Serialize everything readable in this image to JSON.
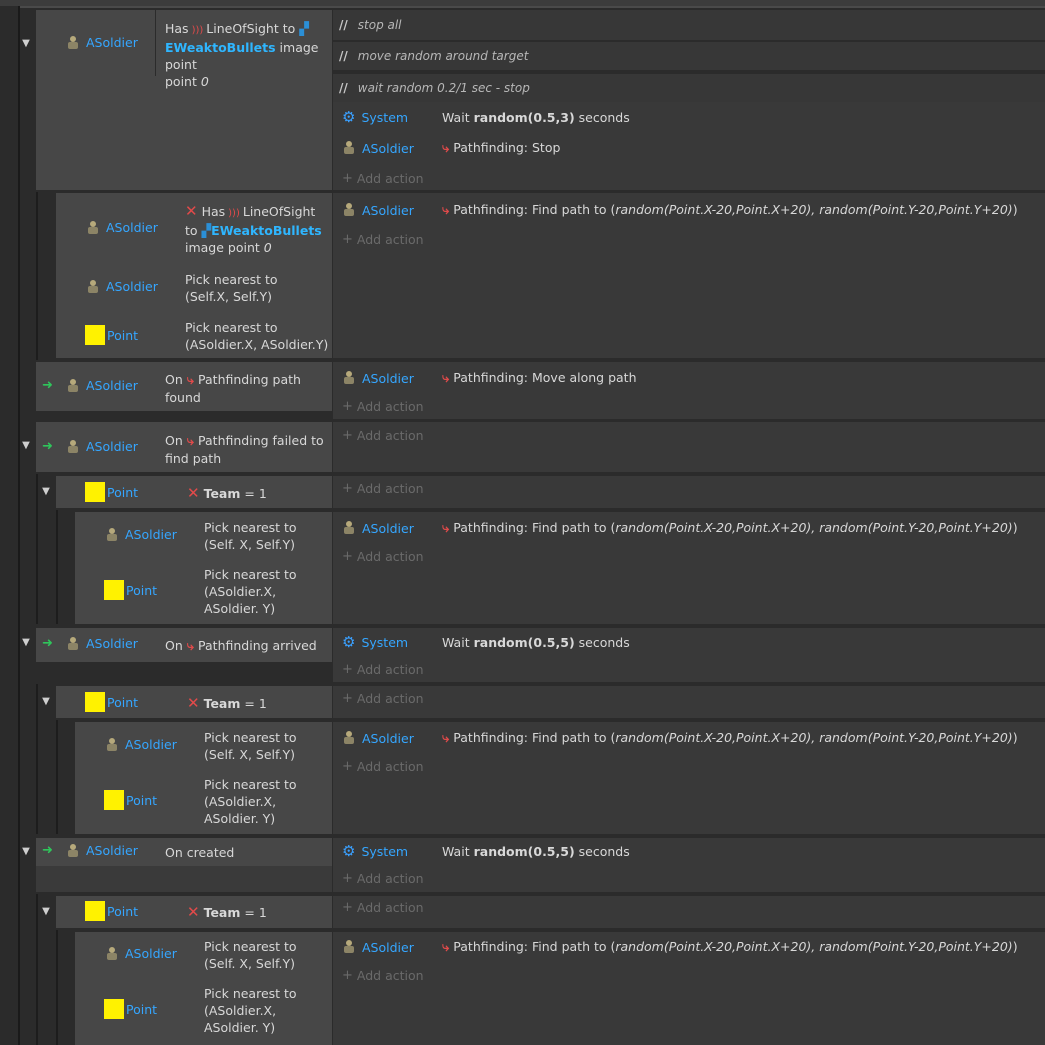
{
  "objects": {
    "soldier": "ASoldier",
    "point": "Point",
    "system": "System",
    "bullets": "EWeaktoBullets"
  },
  "comments": [
    "stop all",
    "move random around target",
    "wait random 0.2/1 sec - stop"
  ],
  "comment_marker": "//",
  "add_action": "Add action",
  "conditions": {
    "has": "Has",
    "line_of_sight_to": "LineOfSight to",
    "line_of_sight": "LineOfSight",
    "to": "to",
    "image_point": "image point",
    "zero": "0",
    "pick_nearest_self": "Pick nearest to (Self.X, Self.Y)",
    "pick_nearest_soldier": "Pick nearest to (ASoldier.X, ASoldier.Y)",
    "pick_nearest_self_2": "Pick nearest to (Self. X, Self.Y)",
    "pick_nearest_soldier_2": "Pick nearest to (ASoldier.X, ASoldier. Y)",
    "on": "On",
    "pathfinding_path": "Pathfinding path",
    "found": "found",
    "pathfinding_failed_to": "Pathfinding failed to",
    "find_path": "find path",
    "pathfinding_arrived": "Pathfinding arrived",
    "on_created": "On created",
    "team": "Team",
    "eq_one": "= 1"
  },
  "actions": {
    "wait": "Wait",
    "seconds": "seconds",
    "random_05_3": "random(0.5,3)",
    "random_05_5": "random(0.5,5)",
    "pf_stop": "Pathfinding: Stop",
    "pf_find_path": "Pathfinding: Find path to (",
    "pf_find_args": "random(Point.X-20,Point.X+20), random(Point.Y-20,Point.Y+20)",
    "close_paren": ")",
    "pf_move_along": "Pathfinding: Move along path"
  },
  "icons": {
    "collapse": "chevron-down-icon",
    "trigger": "trigger-arrow-icon",
    "sprite": "soldier-sprite-icon",
    "point": "yellow-square-icon",
    "system": "gear-icon",
    "pathfinding": "pathfinding-icon",
    "los": "line-of-sight-icon",
    "invert": "red-x-icon"
  },
  "colors": {
    "object_name": "#35a6ff",
    "trigger": "#2fc55b",
    "invert": "#e24a4a",
    "point_swatch": "#fff200"
  }
}
